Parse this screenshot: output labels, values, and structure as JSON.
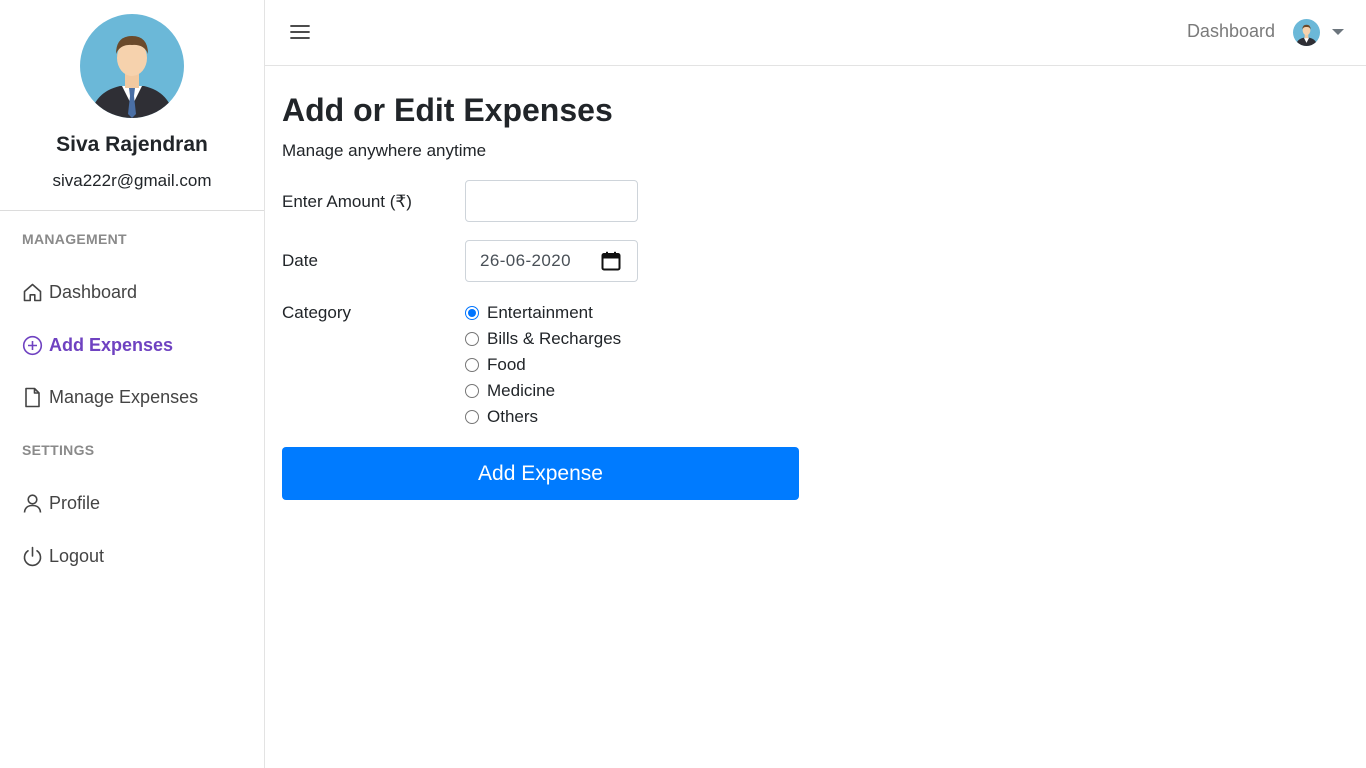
{
  "user": {
    "name": "Siva Rajendran",
    "email": "siva222r@gmail.com"
  },
  "sidebar": {
    "sections": [
      {
        "heading": "MANAGEMENT"
      },
      {
        "heading": "SETTINGS"
      }
    ],
    "items": [
      {
        "label": "Dashboard",
        "icon": "home-icon",
        "active": false
      },
      {
        "label": "Add Expenses",
        "icon": "plus-circle-icon",
        "active": true
      },
      {
        "label": "Manage Expenses",
        "icon": "file-icon",
        "active": false
      },
      {
        "label": "Profile",
        "icon": "person-icon",
        "active": false
      },
      {
        "label": "Logout",
        "icon": "power-icon",
        "active": false
      }
    ]
  },
  "topbar": {
    "dashboard_link": "Dashboard",
    "menu_icon": "hamburger-icon"
  },
  "page": {
    "title": "Add or Edit Expenses",
    "subtitle": "Manage anywhere anytime"
  },
  "form": {
    "amount_label": "Enter Amount (₹)",
    "amount_value": "",
    "date_label": "Date",
    "date_value": "26-06-2020",
    "category_label": "Category",
    "categories": [
      {
        "label": "Entertainment",
        "checked": true
      },
      {
        "label": "Bills & Recharges",
        "checked": false
      },
      {
        "label": "Food",
        "checked": false
      },
      {
        "label": "Medicine",
        "checked": false
      },
      {
        "label": "Others",
        "checked": false
      }
    ],
    "submit_label": "Add Expense"
  },
  "colors": {
    "accent": "#6f42c1",
    "primary": "#007bff",
    "radio": "#0075ff"
  }
}
